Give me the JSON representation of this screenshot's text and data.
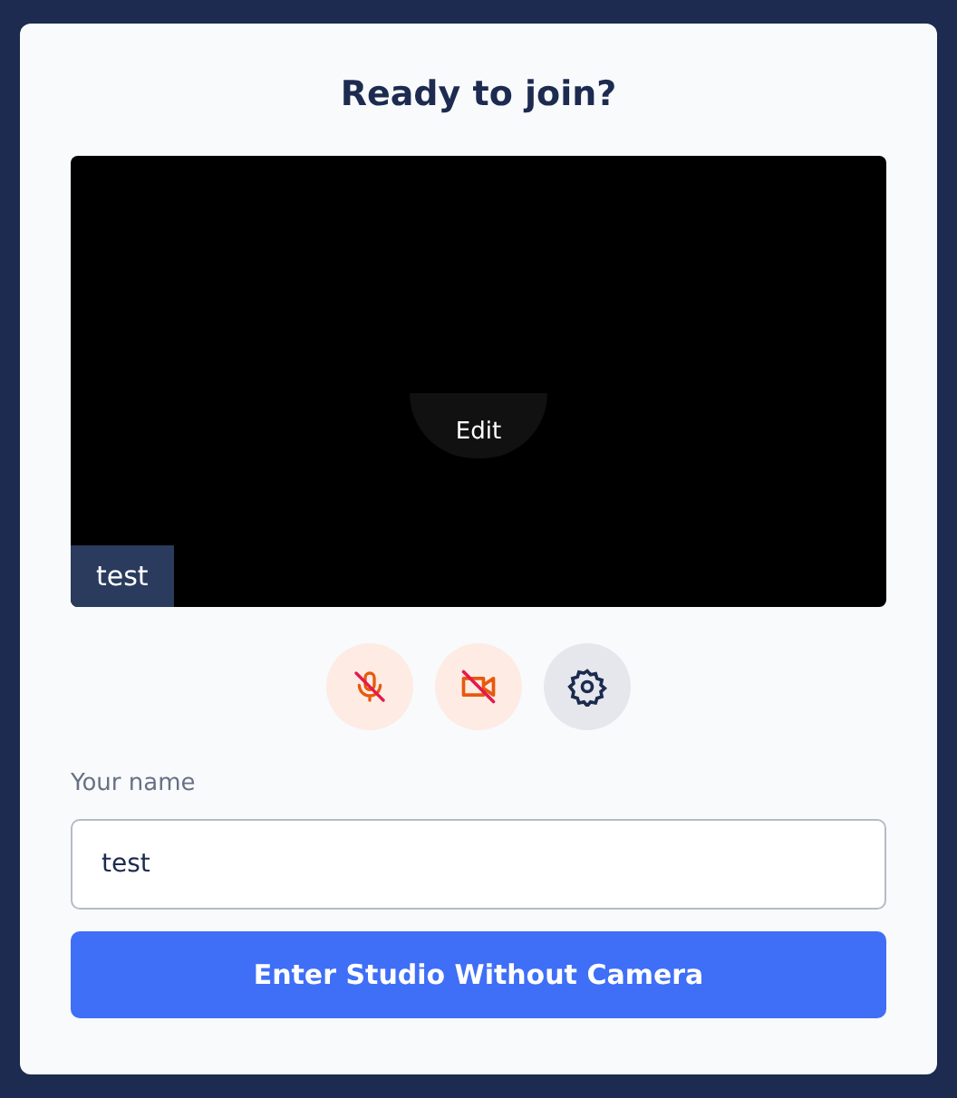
{
  "title": "Ready to join?",
  "preview": {
    "edit_label": "Edit",
    "name_tag": "test"
  },
  "controls": [
    {
      "kind": "mic",
      "off": true
    },
    {
      "kind": "camera",
      "off": true
    },
    {
      "kind": "settings",
      "off": false
    }
  ],
  "name_field": {
    "label": "Your name",
    "value": "test"
  },
  "submit_button": "Enter Studio Without Camera"
}
